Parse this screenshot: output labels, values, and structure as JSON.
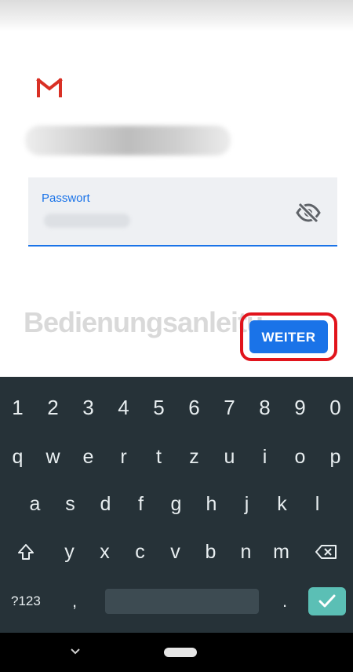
{
  "password_field": {
    "label": "Passwort"
  },
  "watermark": "Bedienungsanleitu",
  "next_button": "WEITER",
  "keyboard": {
    "numbers": [
      "1",
      "2",
      "3",
      "4",
      "5",
      "6",
      "7",
      "8",
      "9",
      "0"
    ],
    "row1": [
      "q",
      "w",
      "e",
      "r",
      "t",
      "z",
      "u",
      "i",
      "o",
      "p"
    ],
    "row2": [
      "a",
      "s",
      "d",
      "f",
      "g",
      "h",
      "j",
      "k",
      "l"
    ],
    "row3": [
      "y",
      "x",
      "c",
      "v",
      "b",
      "n",
      "m"
    ],
    "symbols_key": "?123",
    "comma_key": ",",
    "period_key": "."
  },
  "colors": {
    "accent": "#1a73e8",
    "highlight": "#e1141c",
    "keyboard_bg": "#263238",
    "enter_key": "#5bbfb5"
  }
}
